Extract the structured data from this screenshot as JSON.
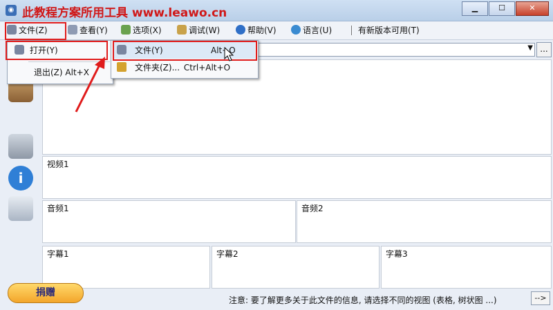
{
  "title": "此教程方案所用工具 www.leawo.cn",
  "window_buttons": {
    "minimize": "▁",
    "maximize": "☐",
    "close": "✕"
  },
  "menubar": {
    "items": [
      "文件(Z)",
      "查看(Y)",
      "选项(X)",
      "调试(W)",
      "帮助(V)",
      "语言(U)"
    ],
    "update_notice": "有新版本可用(T)"
  },
  "file_menu": {
    "open": "打开(Y)",
    "exit": "退出(Z) Alt+X"
  },
  "open_submenu": {
    "file": {
      "label": "文件(Y)",
      "shortcut": "Alt+O"
    },
    "folder": {
      "label": "文件夹(Z)...",
      "shortcut": "Ctrl+Alt+O"
    }
  },
  "combo_button": "...",
  "panels": {
    "general_fragment": "+",
    "video1": "视频1",
    "audio1": "音频1",
    "audio2": "音频2",
    "subtitle1": "字幕1",
    "subtitle2": "字幕2",
    "subtitle3": "字幕3"
  },
  "donate": "捐赠",
  "notice": "注意: 要了解更多关于此文件的信息, 请选择不同的视图 (表格, 树状图 ...)",
  "next_button": "-->",
  "colors": {
    "annotation_red": "#e01b1b"
  },
  "icons": [
    "app-icon",
    "file-icon",
    "view-icon",
    "options-icon",
    "debug-icon",
    "help-icon",
    "language-icon",
    "info-icon"
  ]
}
